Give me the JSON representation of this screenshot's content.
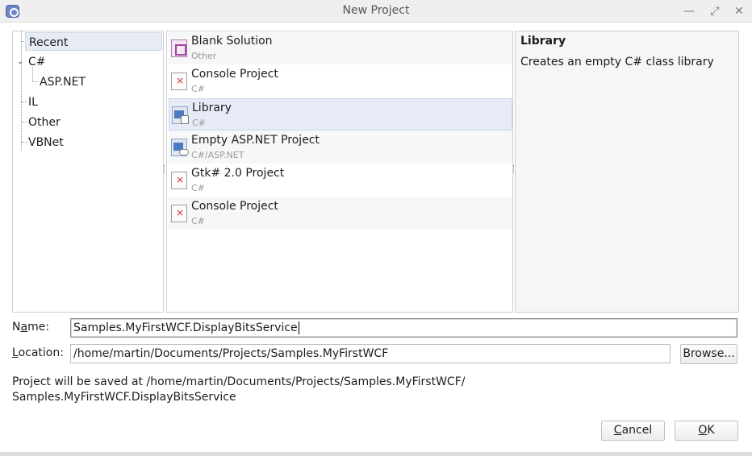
{
  "window": {
    "title": "New Project",
    "controls": [
      "minimize-icon",
      "maximize-icon",
      "close-icon"
    ]
  },
  "categories": [
    {
      "label": "Recent",
      "selected": true
    },
    {
      "label": "C#",
      "expanded": true
    },
    {
      "label": "ASP.NET"
    },
    {
      "label": "IL"
    },
    {
      "label": "Other"
    },
    {
      "label": "VBNet"
    }
  ],
  "templates": [
    {
      "name": "Blank Solution",
      "language": "Other",
      "icon": "solution-icon"
    },
    {
      "name": "Console Project",
      "language": "C#",
      "icon": "console-project-icon"
    },
    {
      "name": "Library",
      "language": "C#",
      "icon": "library-icon",
      "selected": true
    },
    {
      "name": "Empty ASP.NET Project",
      "language": "C#/ASP.NET",
      "icon": "aspnet-project-icon"
    },
    {
      "name": "Gtk# 2.0 Project",
      "language": "C#",
      "icon": "gtk-project-icon"
    },
    {
      "name": "Console Project",
      "language": "C#",
      "icon": "console-project-icon"
    }
  ],
  "description": {
    "title": "Library",
    "text": "Creates an empty C# class library"
  },
  "form": {
    "name_label_pre": "N",
    "name_label_u": "a",
    "name_label_post": "me:",
    "name_value": "Samples.MyFirstWCF.DisplayBitsService",
    "location_label_u": "L",
    "location_label_post": "ocation:",
    "location_value": "/home/martin/Documents/Projects/Samples.MyFirstWCF",
    "browse_label": "Browse..."
  },
  "info": {
    "line1": "Project will be saved at /home/martin/Documents/Projects/Samples.MyFirstWCF/",
    "line2": "Samples.MyFirstWCF.DisplayBitsService"
  },
  "buttons": {
    "cancel_u": "C",
    "cancel_post": "ancel",
    "ok_u": "O",
    "ok_post": "K"
  }
}
